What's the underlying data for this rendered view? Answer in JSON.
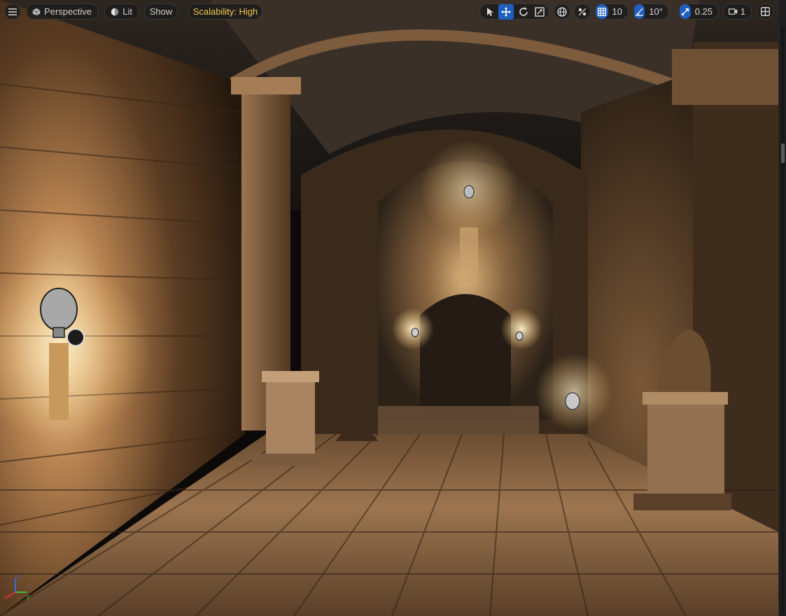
{
  "toolbar": {
    "menu_icon": "hamburger-icon",
    "view_mode": {
      "icon": "perspective-cube-icon",
      "label": "Perspective"
    },
    "lighting": {
      "icon": "lit-sphere-icon",
      "label": "Lit"
    },
    "show_label": "Show",
    "scalability_label": "Scalability: High",
    "transform_tools": [
      {
        "icon": "select-cursor-icon",
        "active": false
      },
      {
        "icon": "translate-move-icon",
        "active": true
      },
      {
        "icon": "rotate-icon",
        "active": false
      },
      {
        "icon": "scale-icon",
        "active": false
      }
    ],
    "coord_space_icon": "world-globe-icon",
    "surface_snap_icon": "surface-snapping-icon",
    "grid_snap": {
      "icon": "grid-snap-icon",
      "value": "10"
    },
    "rotation_snap": {
      "icon": "angle-snap-icon",
      "value": "10°"
    },
    "scale_snap": {
      "icon": "scale-snap-icon",
      "value": "0.25"
    },
    "camera_speed": {
      "icon": "camera-icon",
      "value": "1"
    },
    "layout_icon": "viewport-layout-icon"
  },
  "viewport": {
    "scene": "dungeon-corridor-render",
    "axis_gizmo": {
      "x_color": "#e0313a",
      "y_color": "#3fbf3f",
      "z_color": "#3a6ae0"
    }
  },
  "colors": {
    "accent_blue": "#1f5fbf",
    "scalability_yellow": "#f2c94c",
    "toolbar_text": "#d0d0d0"
  }
}
